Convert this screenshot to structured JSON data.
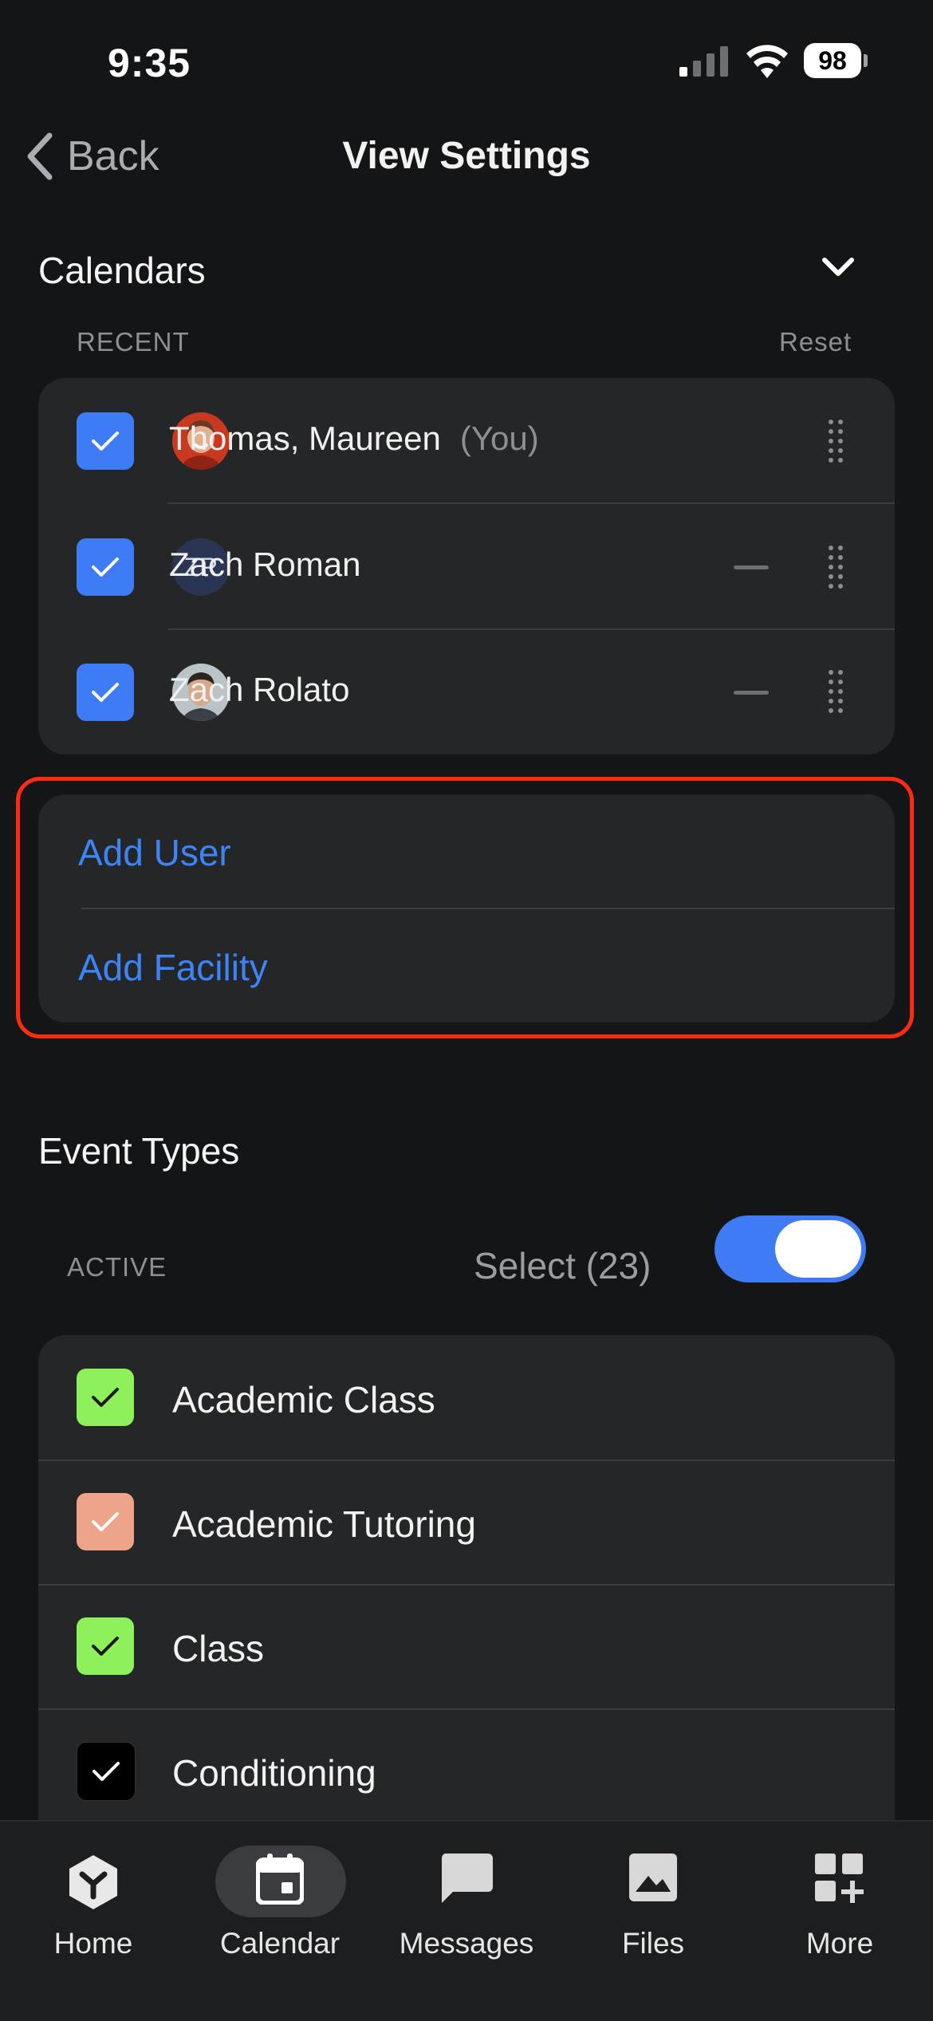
{
  "status_bar": {
    "time": "9:35",
    "battery": "98"
  },
  "nav": {
    "back_label": "Back",
    "title": "View Settings"
  },
  "calendars": {
    "heading": "Calendars",
    "recent_label": "RECENT",
    "reset_label": "Reset",
    "items": [
      {
        "name": "Thomas, Maureen",
        "suffix": "(You)",
        "checked": true
      },
      {
        "name": "Zach Roman",
        "initials": "ZR",
        "checked": true
      },
      {
        "name": "Zach Rolato",
        "checked": true
      }
    ],
    "add_user": "Add User",
    "add_facility": "Add Facility"
  },
  "event_types": {
    "heading": "Event Types",
    "active_label": "ACTIVE",
    "select_label": "Select (23)",
    "toggle_on": true,
    "items": [
      {
        "name": "Academic Class",
        "color": "#8ef05a"
      },
      {
        "name": "Academic Tutoring",
        "color": "#eda48a"
      },
      {
        "name": "Class",
        "color": "#8ef05a"
      },
      {
        "name": "Conditioning",
        "color": "#000000"
      }
    ]
  },
  "tabbar": {
    "tabs": [
      {
        "label": "Home"
      },
      {
        "label": "Calendar"
      },
      {
        "label": "Messages"
      },
      {
        "label": "Files"
      },
      {
        "label": "More"
      }
    ]
  },
  "colors": {
    "accent": "#3d84f7",
    "checkbox_blue": "#3d7cf5",
    "highlight": "#ff2a12"
  }
}
